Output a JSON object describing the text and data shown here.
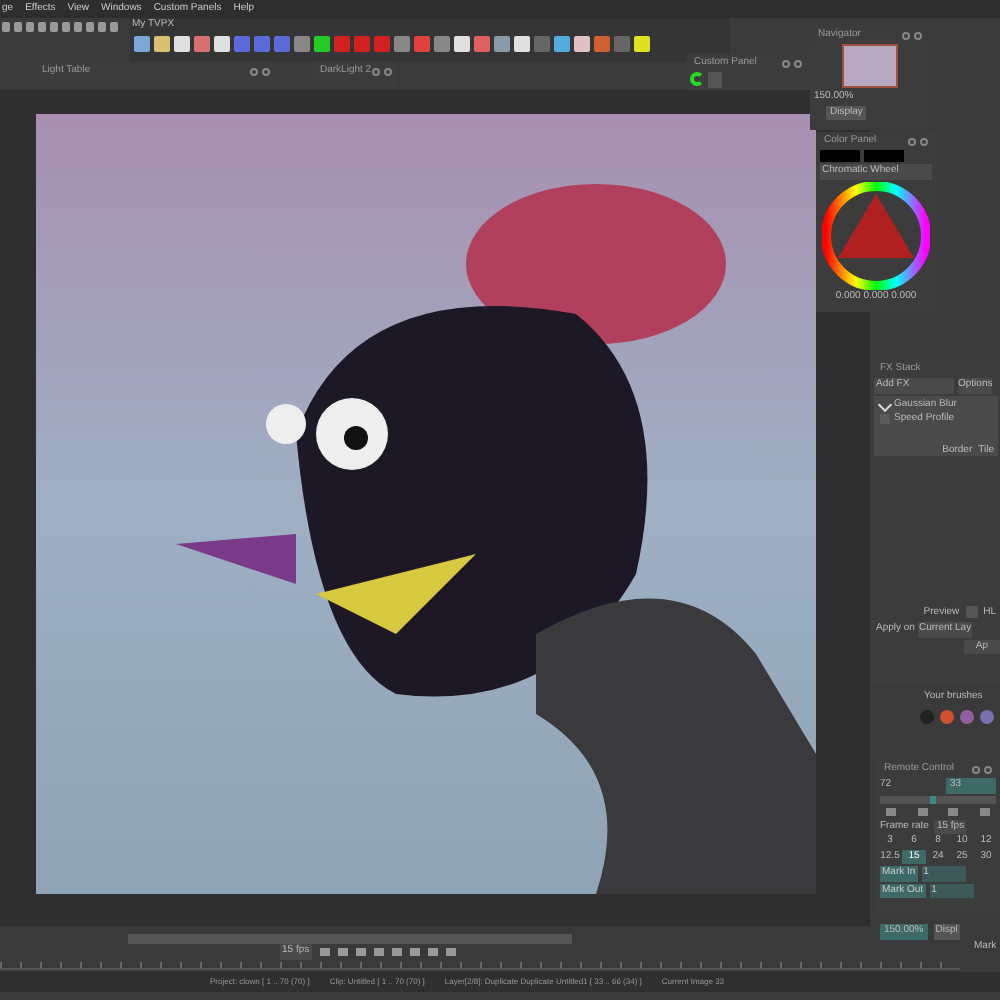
{
  "menu": [
    {
      "label": "ge"
    },
    {
      "label": "Effects"
    },
    {
      "label": "View"
    },
    {
      "label": "Windows"
    },
    {
      "label": "Custom Panels"
    },
    {
      "label": "Help"
    }
  ],
  "toolbar": {
    "title": "My TVPX"
  },
  "light_table": {
    "title": "Light Table"
  },
  "darklight": {
    "title": "DarkLight 2"
  },
  "custom_panel": {
    "title": "Custom Panel"
  },
  "navigator": {
    "title": "Navigator",
    "zoom": "150.00%",
    "display": "Display"
  },
  "color_panel": {
    "title": "Color Panel",
    "mode": "Chromatic Wheel",
    "values": "0.000 0.000 0.000"
  },
  "fx_stack": {
    "title": "FX Stack",
    "add": "Add FX",
    "options": "Options",
    "effects": [
      {
        "name": "Gaussian Blur",
        "checked": true
      },
      {
        "name": "Speed Profile",
        "checked": false
      }
    ],
    "border_label": "Border",
    "border_value": "Tile",
    "preview": "Preview",
    "preview_checked": false,
    "hl": "HL",
    "apply_label": "Apply on",
    "apply_value": "Current Lay",
    "apply_button": "Ap"
  },
  "brushes": {
    "title": "Your brushes"
  },
  "remote": {
    "title": "Remote Control",
    "frame": "72",
    "current": "33",
    "slider": {
      "level": 0.45
    },
    "framerate_label": "Frame rate",
    "framerate": "15 fps",
    "rates": [
      {
        "label": "3",
        "selected": false
      },
      {
        "label": "6",
        "selected": false
      },
      {
        "label": "8",
        "selected": false
      },
      {
        "label": "10",
        "selected": false
      },
      {
        "label": "12",
        "selected": false
      },
      {
        "label": "12.5",
        "selected": false
      },
      {
        "label": "15",
        "selected": true
      },
      {
        "label": "24",
        "selected": false
      },
      {
        "label": "25",
        "selected": false
      },
      {
        "label": "30",
        "selected": false
      }
    ],
    "mark_in": "Mark In",
    "mark_in_value": "1",
    "mark_out": "Mark Out",
    "mark_out_value": "1"
  },
  "transport": {
    "fps": "15 fps",
    "zoom": "150.00%",
    "display": "Displ",
    "mark": "Mark"
  },
  "status_bar": [
    "Project: clown [ 1 .. 70 (70) ]",
    "Clip: Untitled [ 1 .. 70 (70) ]",
    "Layer[2/8]: Duplicate Duplicate Untitled1 [ 33 .. 66 (34) ]",
    "Current Image 33"
  ]
}
